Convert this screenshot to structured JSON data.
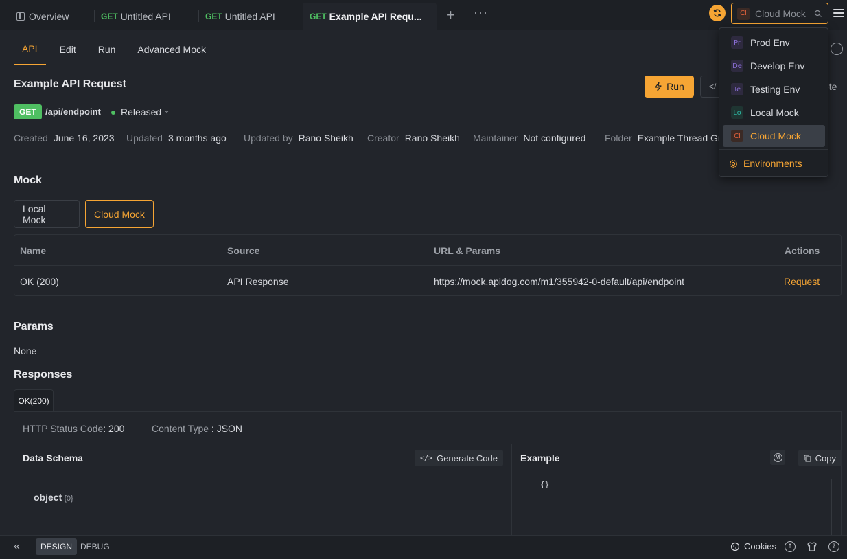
{
  "tabs": [
    {
      "method": "",
      "label": "Overview"
    },
    {
      "method": "GET",
      "label": "Untitled API"
    },
    {
      "method": "GET",
      "label": "Untitled API"
    },
    {
      "method": "GET",
      "label": "Example API Requ..."
    }
  ],
  "tabbar": {
    "add_label": "+",
    "more_label": "···"
  },
  "env_select": {
    "badge": "Cl",
    "value": "Cloud Mock"
  },
  "subtabs": [
    "API",
    "Edit",
    "Run",
    "Advanced Mock"
  ],
  "api": {
    "title": "Example API Request",
    "run_label": "Run",
    "code_label": "</",
    "delete_fragment": "ete",
    "method": "GET",
    "endpoint": "/api/endpoint",
    "status": "Released"
  },
  "meta": {
    "created_label": "Created",
    "created": "June 16, 2023",
    "updated_label": "Updated",
    "updated": "3 months ago",
    "updated_by_label": "Updated by",
    "updated_by": "Rano Sheikh",
    "creator_label": "Creator",
    "creator": "Rano Sheikh",
    "maintainer_label": "Maintainer",
    "maintainer": "Not configured",
    "folder_label": "Folder",
    "folder": "Example Thread Gro"
  },
  "mock": {
    "title": "Mock",
    "tabs": [
      "Local Mock",
      "Cloud Mock"
    ],
    "columns": [
      "Name",
      "Source",
      "URL & Params",
      "Actions"
    ],
    "row": {
      "name": "OK (200)",
      "source": "API Response",
      "url": "https://mock.apidog.com/m1/355942-0-default/api/endpoint",
      "action": "Request"
    }
  },
  "params": {
    "title": "Params",
    "value": "None"
  },
  "responses": {
    "title": "Responses",
    "tab": "OK(200)",
    "status_label": "HTTP Status Code",
    "status_value": "200",
    "content_label": "Content Type",
    "content_value": "JSON",
    "schema_title": "Data Schema",
    "generate_label": "Generate Code",
    "example_title": "Example",
    "m_label": "M",
    "copy_label": "Copy",
    "schema_type": "object",
    "schema_count": "{0}",
    "example_code": "{}"
  },
  "dropdown": {
    "items": [
      {
        "badge": "Pr",
        "label": "Prod Env",
        "color": "#8b6fd6"
      },
      {
        "badge": "De",
        "label": "Develop Env",
        "color": "#8b6fd6"
      },
      {
        "badge": "Te",
        "label": "Testing Env",
        "color": "#8b6fd6"
      },
      {
        "badge": "Lo",
        "label": "Local Mock",
        "color": "#2db6a3"
      },
      {
        "badge": "Cl",
        "label": "Cloud Mock",
        "color": "#e0603c"
      }
    ],
    "environments_label": "Environments"
  },
  "bottombar": {
    "collapse": "«",
    "modes": [
      "DESIGN",
      "DEBUG"
    ],
    "cookies_label": "Cookies"
  },
  "colors": {
    "accent": "#f6a534",
    "get": "#4fbf62",
    "bg": "#22252b"
  }
}
